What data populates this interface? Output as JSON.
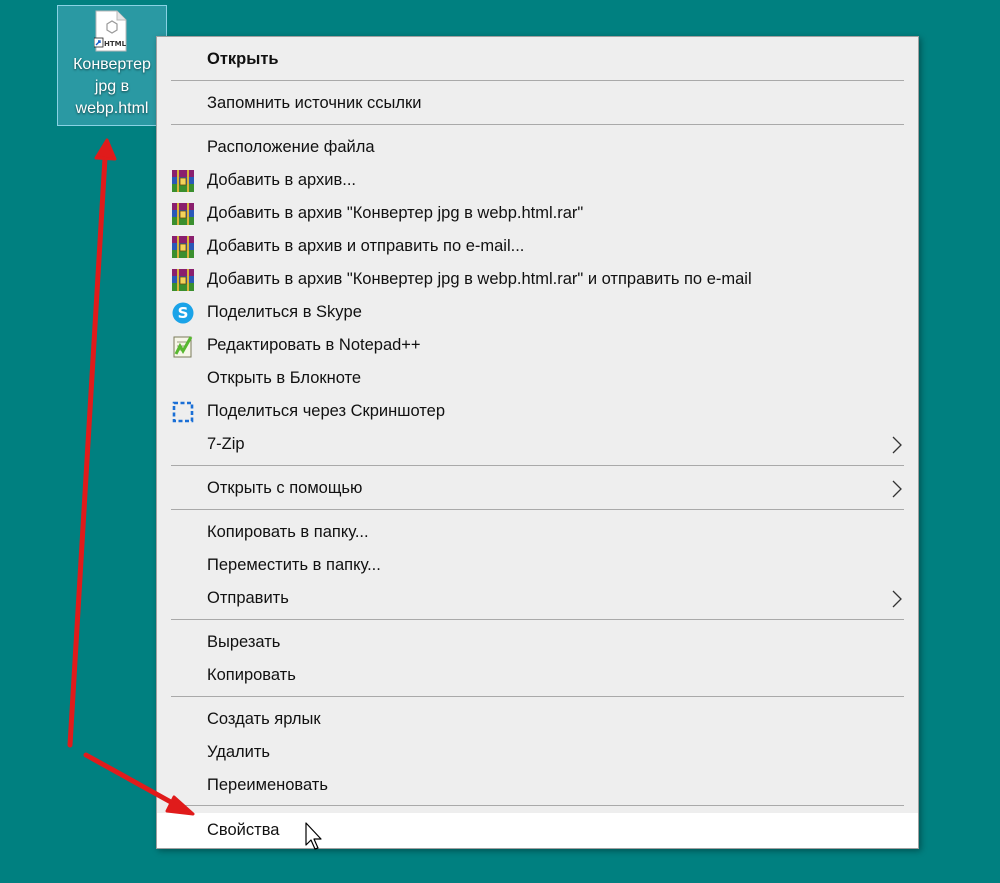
{
  "desktop": {
    "background_color": "#008080",
    "icon": {
      "badge_text": "HTML",
      "label_lines": [
        "Конвертер",
        "jpg в",
        "webp.html"
      ]
    }
  },
  "context_menu": {
    "items": [
      {
        "label": "Открыть",
        "bold": true,
        "icon": null
      },
      {
        "label": "Запомнить источник ссылки",
        "icon": null
      },
      {
        "label": "Расположение файла",
        "icon": null
      },
      {
        "label": "Добавить в архив...",
        "icon": "winrar-icon"
      },
      {
        "label": "Добавить в архив \"Конвертер jpg в webp.html.rar\"",
        "icon": "winrar-icon"
      },
      {
        "label": "Добавить в архив и отправить по e-mail...",
        "icon": "winrar-icon"
      },
      {
        "label": "Добавить в архив \"Конвертер jpg в webp.html.rar\" и отправить по e-mail",
        "icon": "winrar-icon"
      },
      {
        "label": "Поделиться в Skype",
        "icon": "skype-icon"
      },
      {
        "label": "Редактировать в Notepad++",
        "icon": "notepad-plus-plus-icon"
      },
      {
        "label": "Открыть в Блокноте",
        "icon": null
      },
      {
        "label": "Поделиться через Скриншотер",
        "icon": "screenshot-icon"
      },
      {
        "label": "7-Zip",
        "icon": null,
        "submenu": true
      },
      {
        "label": "Открыть с помощью",
        "icon": null,
        "submenu": true
      },
      {
        "label": "Копировать в папку...",
        "icon": null
      },
      {
        "label": "Переместить в папку...",
        "icon": null
      },
      {
        "label": "Отправить",
        "icon": null,
        "submenu": true
      },
      {
        "label": "Вырезать",
        "icon": null
      },
      {
        "label": "Копировать",
        "icon": null
      },
      {
        "label": "Создать ярлык",
        "icon": null
      },
      {
        "label": "Удалить",
        "icon": null
      },
      {
        "label": "Переименовать",
        "icon": null
      },
      {
        "label": "Свойства",
        "icon": null,
        "highlighted": true
      }
    ]
  },
  "colors": {
    "menu_background": "#eeeeee",
    "menu_highlight": "#ffffff",
    "separator": "#a9a9a9",
    "annotation_arrow": "#e01b1b"
  }
}
